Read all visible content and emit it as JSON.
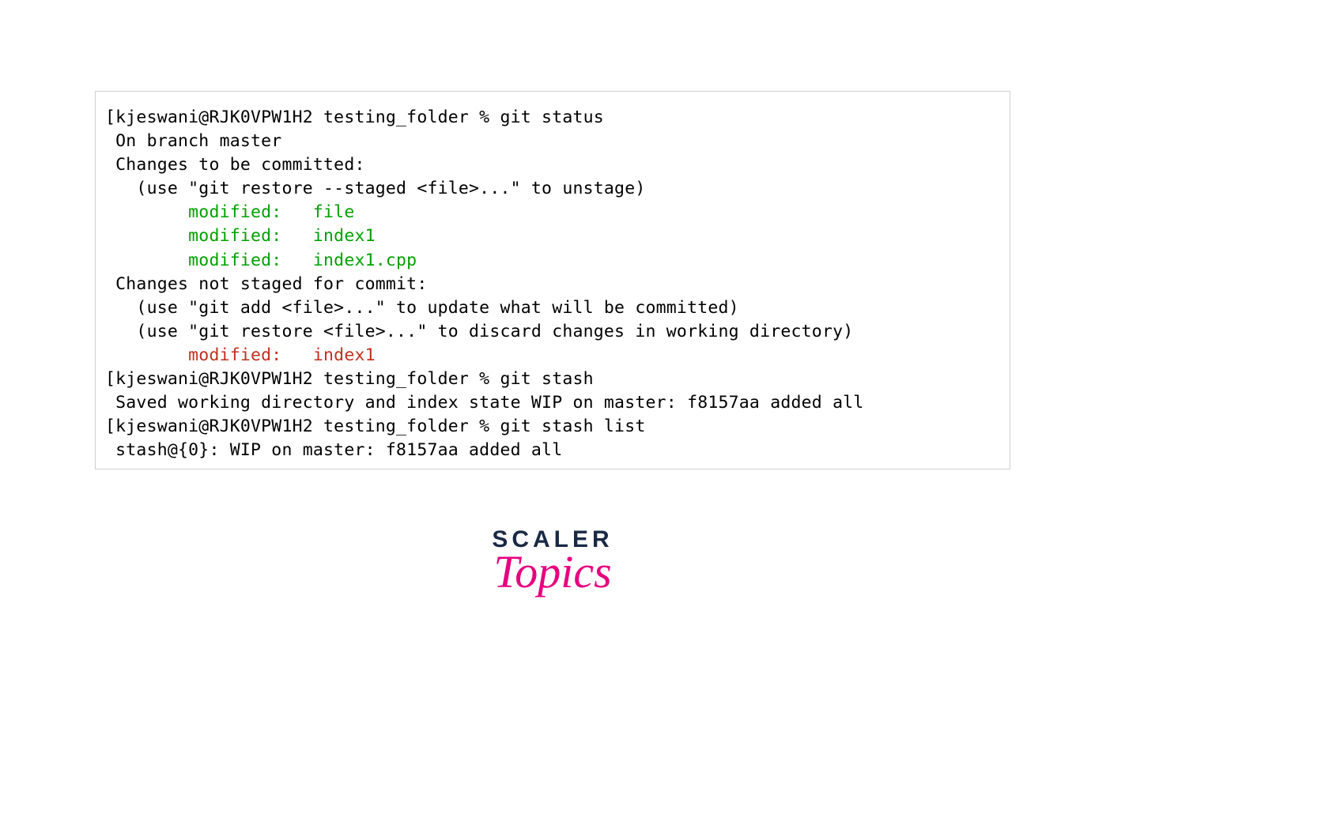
{
  "terminal": {
    "prompt1": "[kjeswani@RJK0VPW1H2 testing_folder % git status",
    "line_branch": " On branch master",
    "line_changes_header": " Changes to be committed:",
    "line_unstage_hint": "   (use \"git restore --staged <file>...\" to unstage)",
    "staged_file1": "\tmodified:   file",
    "staged_file2": "\tmodified:   index1",
    "staged_file3": "\tmodified:   index1.cpp",
    "blank1": "",
    "line_notstaged_header": " Changes not staged for commit:",
    "line_add_hint": "   (use \"git add <file>...\" to update what will be committed)",
    "line_restore_hint": "   (use \"git restore <file>...\" to discard changes in working directory)",
    "unstaged_file1": "\tmodified:   index1",
    "blank2": "",
    "prompt2": "[kjeswani@RJK0VPW1H2 testing_folder % git stash",
    "line_saved": " Saved working directory and index state WIP on master: f8157aa added all",
    "prompt3": "[kjeswani@RJK0VPW1H2 testing_folder % git stash list",
    "line_stashlist": " stash@{0}: WIP on master: f8157aa added all"
  },
  "logo": {
    "scaler": "SCALER",
    "topics": "Topics"
  }
}
